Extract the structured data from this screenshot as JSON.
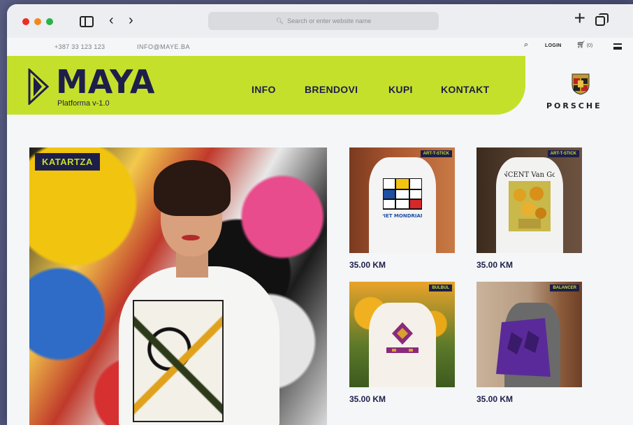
{
  "browser": {
    "address_placeholder": "Search or enter website name"
  },
  "topbar": {
    "phone": "+387 33 123 123",
    "email": "INFO@MAYE.BA",
    "login": "LOGIN",
    "cart_count": "(0)"
  },
  "brand": {
    "name": "MAYA",
    "subtitle": "Platforma v-1.0"
  },
  "nav": {
    "items": [
      "INFO",
      "BRENDOVI",
      "KUPI",
      "KONTAKT"
    ]
  },
  "sponsor": {
    "name": "PORSCHE"
  },
  "hero": {
    "badge": "KATARTZA"
  },
  "products": [
    {
      "tag": "ART-T-STICK",
      "price": "35.00 KM",
      "print_text": "PIET MONDRIAN"
    },
    {
      "tag": "ART-T-STICK",
      "price": "35.00 KM",
      "print_text": "VINCENT Van Gogh"
    },
    {
      "tag": "BULBUL",
      "price": "35.00 KM"
    },
    {
      "tag": "BALANCER",
      "price": "35.00 KM"
    }
  ],
  "colors": {
    "brand_lime": "#c5e02b",
    "brand_navy": "#1e1e4a"
  }
}
